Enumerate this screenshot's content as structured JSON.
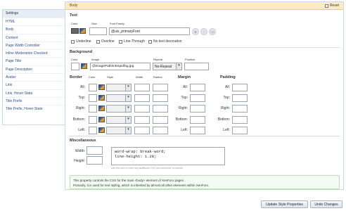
{
  "sidebar": {
    "header": "Settings",
    "items": [
      "HTML",
      "Body",
      "Content",
      "Page Width Controller",
      "Inline Moderation Checked",
      "Page Title",
      "Page Description",
      "Avatar",
      "Link",
      "Link, Hover State",
      "Title Prefix",
      "Title Prefix, Hover State"
    ]
  },
  "panel": {
    "title": "Body",
    "reset_label": "Reset"
  },
  "text": {
    "section": "Text",
    "color_label": "Color",
    "size_label": "Size",
    "font_family_label": "Font Family",
    "font_family_value": "@uix_primaryFont",
    "bold": "B",
    "italic": "I",
    "case": "Aa",
    "underline": "Underline",
    "overline": "Overline",
    "line_through": "Line-Through",
    "no_decoration": "No text decoration"
  },
  "background": {
    "section": "Background",
    "color_label": "Color",
    "image_label": "Image",
    "image_value": "@imagePath/intrepid/bg.jpg",
    "repeat_label": "Repeat",
    "repeat_value": "No-Repeat",
    "position_label": "Position"
  },
  "border": {
    "section": "Border",
    "color_label": "Color",
    "style_label": "Style",
    "width_label": "Width",
    "radius_label": "Radius",
    "rows": [
      "All:",
      "Top:",
      "Right:",
      "Bottom:",
      "Left:"
    ]
  },
  "margin": {
    "section": "Margin",
    "rows": [
      "All:",
      "Top:",
      "Right:",
      "Bottom:",
      "Left:"
    ]
  },
  "padding": {
    "section": "Padding",
    "rows": [
      "All:",
      "Top:",
      "Right:",
      "Bottom:",
      "Left:"
    ]
  },
  "misc": {
    "section": "Miscellaneous",
    "width_label": "Width:",
    "height_label": "Height:",
    "css_line1": "word-wrap: break-word;",
    "css_line2": "line-height: 1.28;",
    "hint": "Use this box to enter any additional CSS you would like to include."
  },
  "description": {
    "line1": "This property controls the CSS for the main <body> element of XenForo pages.",
    "line2": "Primarily, it is used for text styling, which is inherited by almost all other elements within XenForo."
  },
  "buttons": {
    "update": "Update Style Properties",
    "undo": "Undo Changes"
  }
}
